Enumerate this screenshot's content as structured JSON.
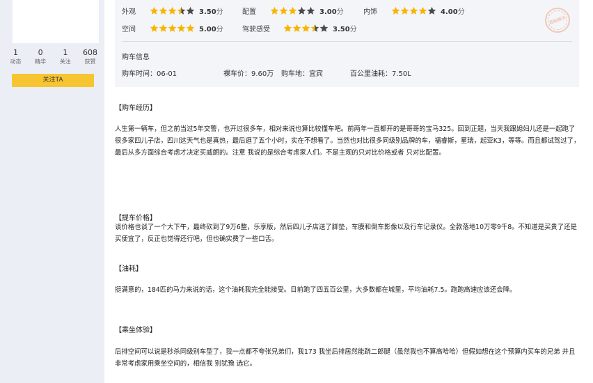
{
  "profile": {
    "stats": [
      {
        "num": "1",
        "label": "动态"
      },
      {
        "num": "0",
        "label": "精华"
      },
      {
        "num": "1",
        "label": "关注"
      },
      {
        "num": "608",
        "label": "获赞"
      }
    ],
    "follow_label": "关注TA"
  },
  "scores": [
    {
      "name": "外观",
      "stars": 3.5,
      "value": "3.50",
      "unit": "分"
    },
    {
      "name": "配置",
      "stars": 3.0,
      "value": "3.00",
      "unit": "分"
    },
    {
      "name": "内饰",
      "stars": 4.0,
      "value": "4.00",
      "unit": "分"
    },
    {
      "name": "空间",
      "stars": 5.0,
      "value": "5.00",
      "unit": "分"
    },
    {
      "name": "驾驶感受",
      "stars": 3.5,
      "value": "3.50",
      "unit": "分"
    }
  ],
  "colors": {
    "star_on": "#f7b500",
    "star_off": "#4a4a4a",
    "accent": "#f7c531"
  },
  "badge_text": "超级精华",
  "purchase": {
    "title": "购车信息",
    "time": "购车时间：06-01",
    "price": "裸车价：9.60万",
    "place": "购车地：宜宾",
    "fuel": "百公里油耗：7.50L"
  },
  "sections": [
    {
      "title": "【购车经历】",
      "text": "人生第一辆车，但之前当过5年交警，也开过很多车，相对来说也算比较懂车吧。前两年一直都开的是哥哥的宝马325。回到正题，当天我跟媳妇儿还是一起跑了很多家四儿子店，四川这天气也是真热，最后逛了五个小时，实在不想看了。当然也对比很多同级别品牌的车，福睿斯，星瑞，起亚K3，等等。而且都试驾过了，最后从多方面综合考虑才决定买威朗的。注意 我说的是综合考虑家人们。不是主观的只对比价格或者 只对比配置。"
    },
    {
      "title": "【提车价格】",
      "text": "谈价格也谈了一个大下午，最终砍到了9万6整，乐享版，然后四儿子店送了脚垫，车膜和倒车影像以及行车记录仪。全款落地10万零9千8。不知道是买贵了还是买便宜了，反正也觉得还行吧，但也确实费了一些口舌。"
    },
    {
      "title": "【油耗】",
      "text": "挺满意的，184匹的马力来说的话，这个油耗我完全能接受。目前跑了四五百公里，大多数都在城里，平均油耗7.5。跑跑高速应该还会降。"
    },
    {
      "title": "【乘坐体验】",
      "text": "后排空间可以说是秒杀同级别车型了，我一点都不夸张兄弟们，我173 我坐后排居然能跷二郎腿（虽然我也不算高哈哈）但假如想在这个预算内买车的兄弟 并且非常考虑家用乘坐空间的，相信我 别犹豫 选它。"
    }
  ]
}
